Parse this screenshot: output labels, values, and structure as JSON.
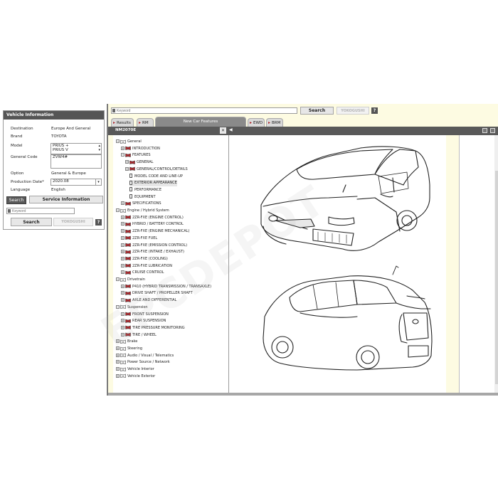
{
  "vehicle_panel": {
    "title": "Vehicle Information",
    "rows": [
      {
        "label": "Destination",
        "value": "Europe And General"
      },
      {
        "label": "Brand",
        "value": "TOYOTA"
      },
      {
        "label": "Model",
        "value": "PRIUS +"
      },
      {
        "label": "General Code",
        "value": "ZVW4#"
      },
      {
        "label": "Option",
        "value": "General & Europe"
      },
      {
        "label": "Production Date*",
        "value": "2020.08"
      },
      {
        "label": "Language",
        "value": "English"
      }
    ],
    "model_list": [
      "PRIUS +",
      "PRIUS V"
    ],
    "search_tab_label": "Search",
    "service_info_label": "Service Information",
    "keyword_placeholder": "Keyword",
    "search_button": "Search",
    "yokogushi_button": "YOKOGUSHI",
    "help": "?"
  },
  "main": {
    "keyword_placeholder": "Keyword",
    "search_button": "Search",
    "yokogushi_button": "YOKOGUSHI",
    "help": "?",
    "tabs": [
      "Results",
      "RM",
      "New Car Features",
      "EWD",
      "BRM"
    ],
    "doc_code": "NM2070E",
    "close_symbol": "✕",
    "expand_symbol": "◀"
  },
  "tree": [
    {
      "label": "General",
      "level": 0,
      "sign": "-",
      "icon": "book"
    },
    {
      "label": "INTRODUCTION",
      "level": 1,
      "sign": "+",
      "icon": "book"
    },
    {
      "label": "FEATURES",
      "level": 1,
      "sign": "-",
      "icon": "book"
    },
    {
      "label": "GENERAL",
      "level": 2,
      "sign": "+",
      "icon": "book"
    },
    {
      "label": "GENERAL/CONTROL/DETAILS",
      "level": 2,
      "sign": "+",
      "icon": "book"
    },
    {
      "label": "MODEL CODE AND LINE-UP",
      "level": 3,
      "sign": "",
      "icon": "doc"
    },
    {
      "label": "EXTERIOR APPEARANCE",
      "level": 3,
      "sign": "",
      "icon": "doc",
      "selected": true
    },
    {
      "label": "PERFORMANCE",
      "level": 3,
      "sign": "",
      "icon": "doc"
    },
    {
      "label": "EQUIPMENT",
      "level": 3,
      "sign": "",
      "icon": "doc"
    },
    {
      "label": "SPECIFICATIONS",
      "level": 1,
      "sign": "+",
      "icon": "book"
    },
    {
      "label": "Engine / Hybrid System",
      "level": 0,
      "sign": "-",
      "icon": "book"
    },
    {
      "label": "2ZR-FXE (ENGINE CONTROL)",
      "level": 1,
      "sign": "+",
      "icon": "book"
    },
    {
      "label": "HYBRID / BATTERY CONTROL",
      "level": 1,
      "sign": "+",
      "icon": "book"
    },
    {
      "label": "2ZR-FXE (ENGINE MECHANICAL)",
      "level": 1,
      "sign": "+",
      "icon": "book"
    },
    {
      "label": "2ZR-FXE FUEL",
      "level": 1,
      "sign": "+",
      "icon": "book"
    },
    {
      "label": "2ZR-FXE (EMISSION CONTROL)",
      "level": 1,
      "sign": "+",
      "icon": "book"
    },
    {
      "label": "2ZR-FXE (INTAKE / EXHAUST)",
      "level": 1,
      "sign": "+",
      "icon": "book"
    },
    {
      "label": "2ZR-FXE (COOLING)",
      "level": 1,
      "sign": "+",
      "icon": "book"
    },
    {
      "label": "2ZR-FXE LUBRICATION",
      "level": 1,
      "sign": "+",
      "icon": "book"
    },
    {
      "label": "CRUISE CONTROL",
      "level": 1,
      "sign": "+",
      "icon": "book"
    },
    {
      "label": "Drivetrain",
      "level": 0,
      "sign": "-",
      "icon": "book"
    },
    {
      "label": "P410 (HYBRID TRANSMISSION / TRANSAXLE)",
      "level": 1,
      "sign": "+",
      "icon": "book"
    },
    {
      "label": "DRIVE SHAFT / PROPELLER SHAFT",
      "level": 1,
      "sign": "+",
      "icon": "book"
    },
    {
      "label": "AXLE AND DIFFERENTIAL",
      "level": 1,
      "sign": "+",
      "icon": "book"
    },
    {
      "label": "Suspension",
      "level": 0,
      "sign": "-",
      "icon": "book"
    },
    {
      "label": "FRONT SUSPENSION",
      "level": 1,
      "sign": "+",
      "icon": "book"
    },
    {
      "label": "REAR SUSPENSION",
      "level": 1,
      "sign": "+",
      "icon": "book"
    },
    {
      "label": "TIRE PRESSURE MONITORING",
      "level": 1,
      "sign": "+",
      "icon": "book"
    },
    {
      "label": "TIRE / WHEEL",
      "level": 1,
      "sign": "+",
      "icon": "book"
    },
    {
      "label": "Brake",
      "level": 0,
      "sign": "+",
      "icon": "book"
    },
    {
      "label": "Steering",
      "level": 0,
      "sign": "+",
      "icon": "book"
    },
    {
      "label": "Audio / Visual / Telematics",
      "level": 0,
      "sign": "+",
      "icon": "book"
    },
    {
      "label": "Power Source / Network",
      "level": 0,
      "sign": "+",
      "icon": "book"
    },
    {
      "label": "Vehicle Interior",
      "level": 0,
      "sign": "+",
      "icon": "book"
    },
    {
      "label": "Vehicle Exterior",
      "level": 0,
      "sign": "+",
      "icon": "book"
    }
  ],
  "watermark": "EPCDEPOT",
  "colors": {
    "accent_red": "#b0282d",
    "bar_dark": "#595959",
    "bg_cream": "#fdfbe2"
  }
}
